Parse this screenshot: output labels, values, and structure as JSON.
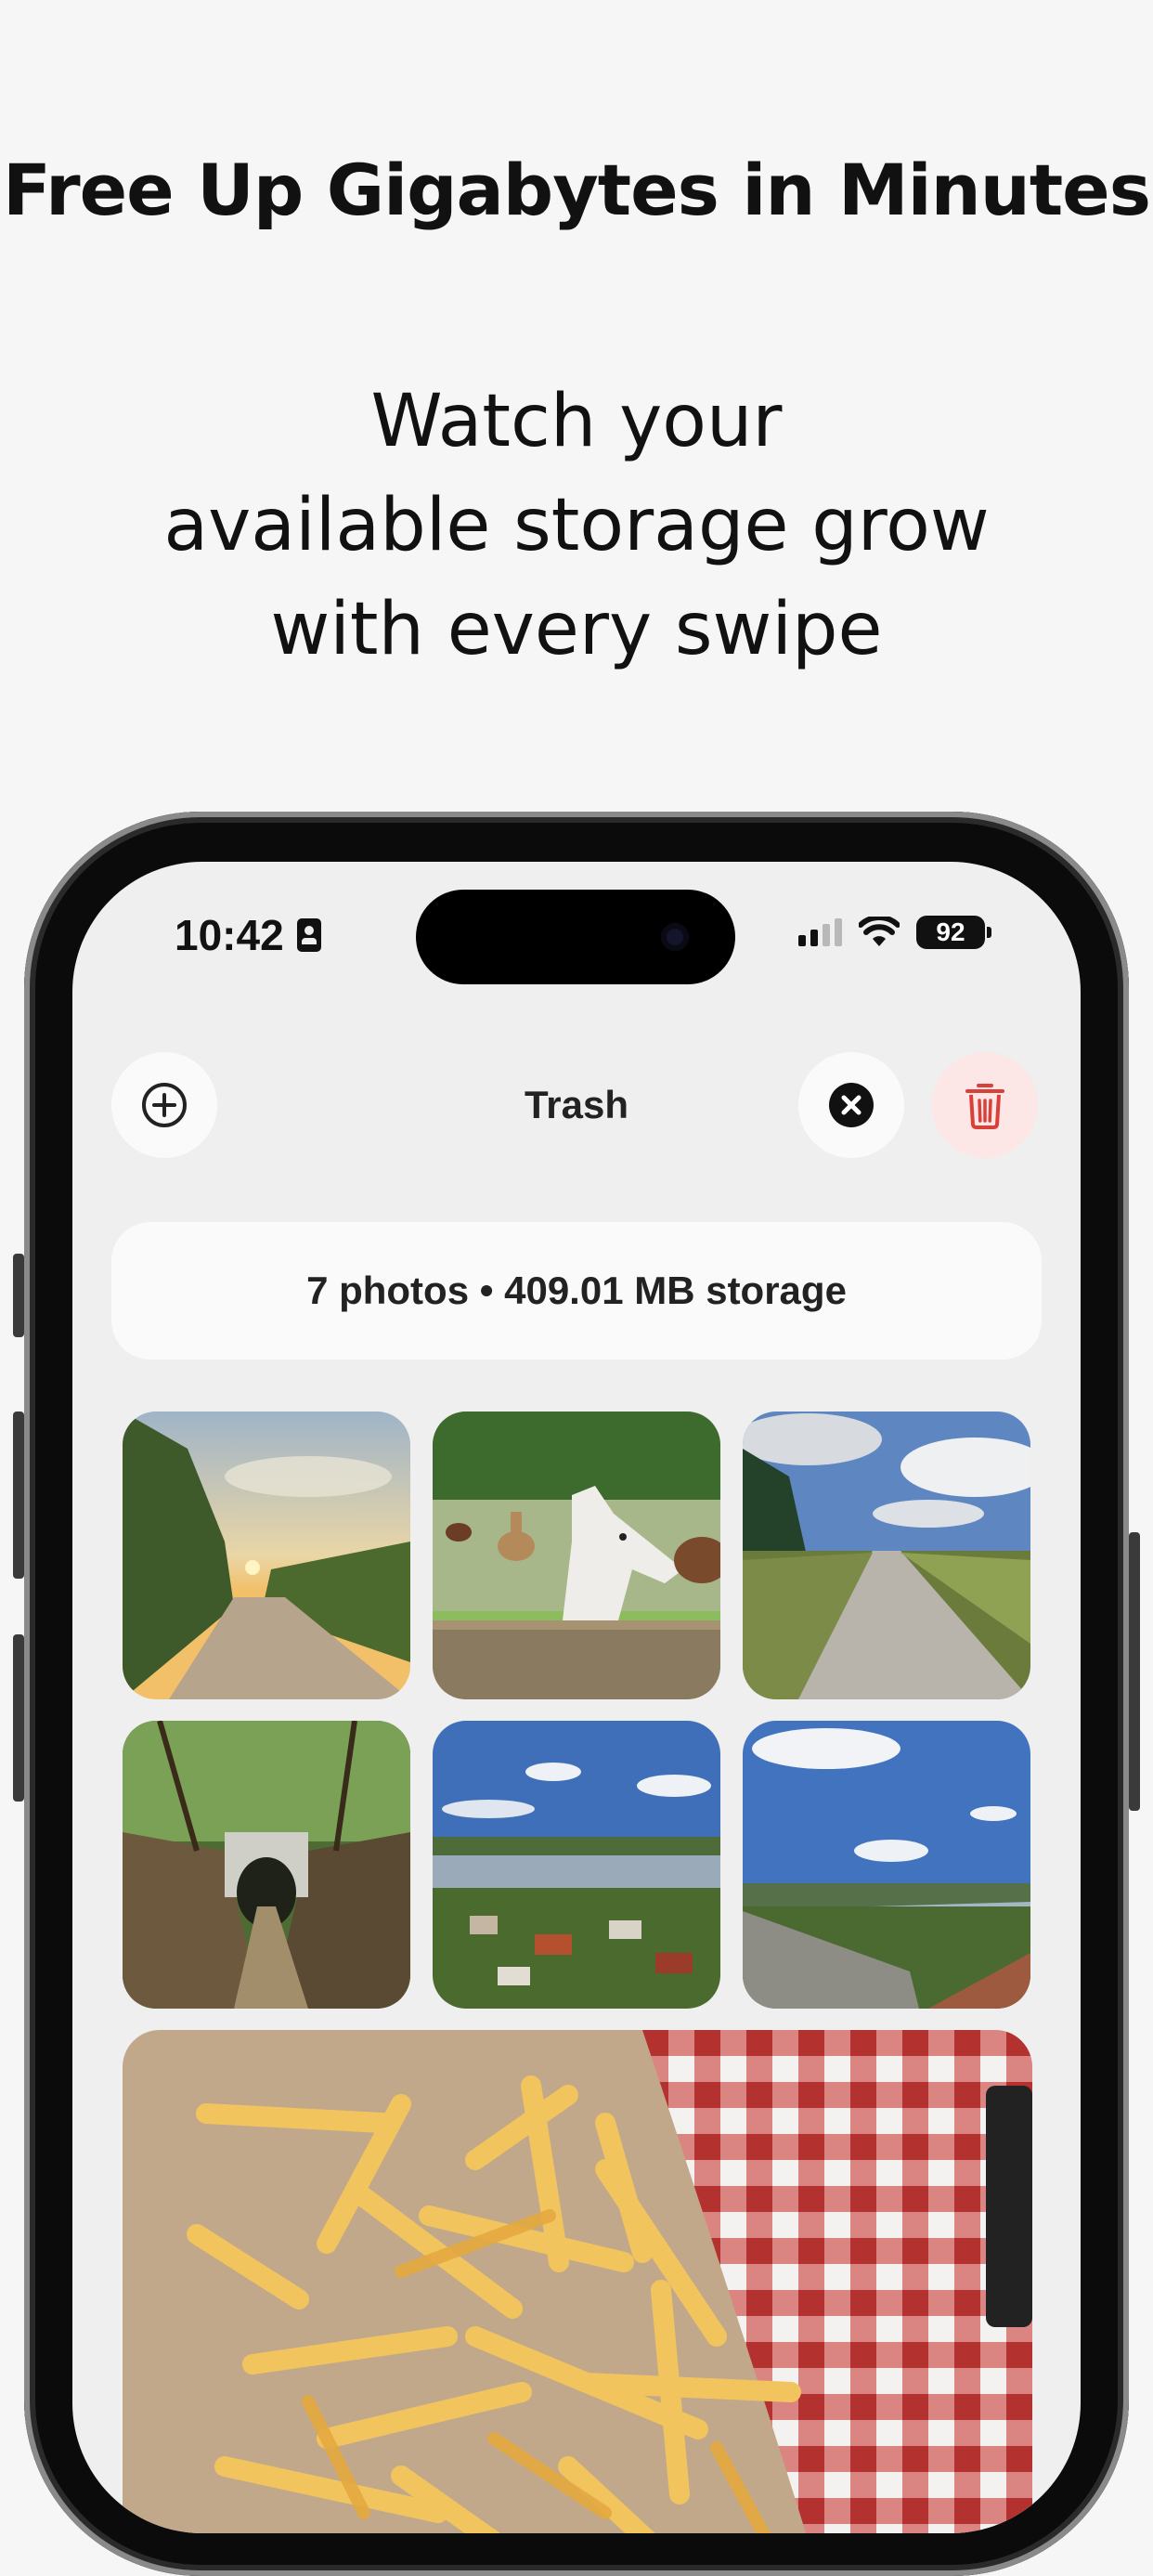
{
  "promo": {
    "headline": "Free Up Gigabytes in Minutes",
    "sub_lines": [
      "Watch your",
      "available storage grow",
      "with every swipe"
    ]
  },
  "status_bar": {
    "time": "10:42",
    "battery": "92"
  },
  "toolbar": {
    "title": "Trash",
    "add_icon": "plus-circle-icon",
    "close_icon": "close-circle-icon",
    "delete_icon": "trash-icon"
  },
  "summary": "7 photos • 409.01 MB storage",
  "photos": [
    {
      "name": "sunset-path-photo"
    },
    {
      "name": "alpacas-photo"
    },
    {
      "name": "cobblestone-road-photo"
    },
    {
      "name": "tunnel-ravine-photo"
    },
    {
      "name": "river-town-photo"
    },
    {
      "name": "river-overlook-photo"
    },
    {
      "name": "french-fries-photo"
    }
  ],
  "colors": {
    "page_bg": "#f6f6f6",
    "screen_bg": "#efefef",
    "delete_accent": "#d9403a",
    "delete_bg": "#fde6e6"
  }
}
